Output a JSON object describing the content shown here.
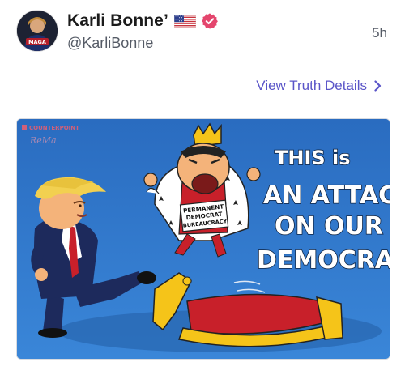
{
  "post": {
    "author_name": "Karli Bonne’",
    "handle": "@KarliBonne",
    "timestamp": "5h",
    "flag_icon": "us-flag-icon",
    "verified_icon": "verified-badge-icon",
    "verified_color": "#e4456d",
    "avatar_label": "MAGA"
  },
  "details_link": {
    "label": "View Truth Details",
    "color": "#5a55c8",
    "icon": "chevron-right-icon"
  },
  "media": {
    "watermark": "COUNTERPOINT",
    "headline_lines": [
      "THIS is",
      "AN ATTACK",
      "ON OUR",
      "DEMOCRACY"
    ],
    "sign_lines": [
      "PERMANENT",
      "DEMOCRAT",
      "BUREAUCRACY"
    ],
    "background_color": "#2d72c4"
  }
}
